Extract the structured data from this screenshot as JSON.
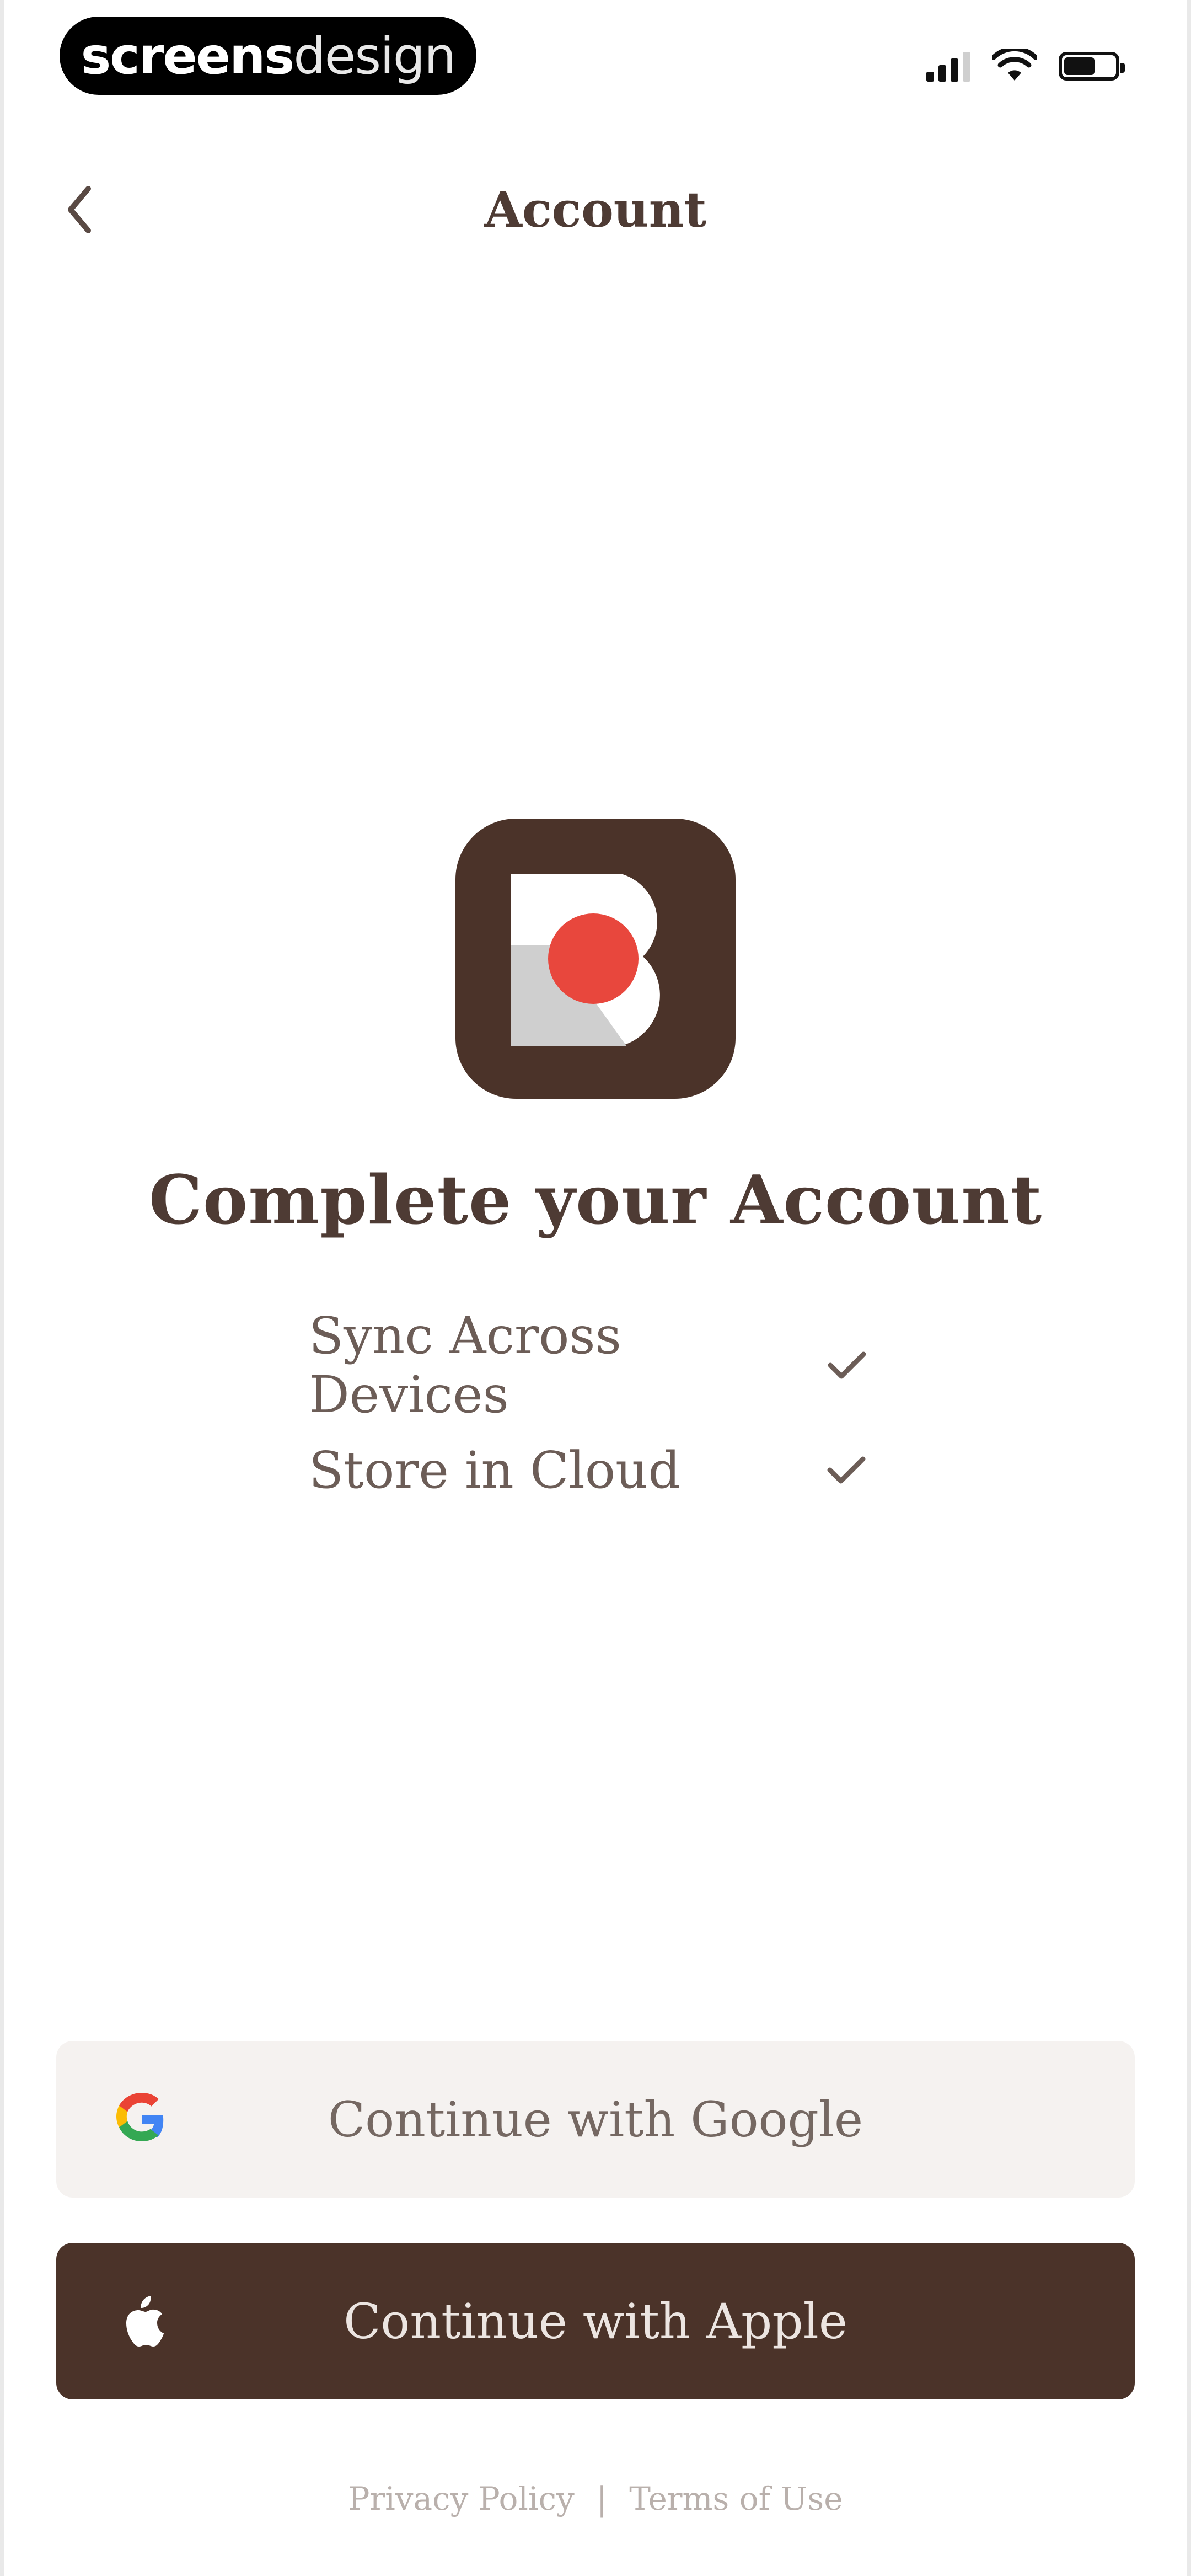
{
  "status_bar": {
    "badge_bold": "screens",
    "badge_light": "design",
    "icons": [
      "cellular-signal-icon",
      "wifi-icon",
      "battery-icon"
    ]
  },
  "nav": {
    "back_icon": "chevron-left-icon",
    "title": "Account"
  },
  "hero": {
    "logo": "app-logo-b-icon",
    "headline": "Complete your Account",
    "features": [
      {
        "label": "Sync Across Devices",
        "icon": "checkmark-icon"
      },
      {
        "label": "Store in Cloud",
        "icon": "checkmark-icon"
      }
    ]
  },
  "actions": {
    "google_label": "Continue with Google",
    "google_icon": "google-icon",
    "apple_label": "Continue with Apple",
    "apple_icon": "apple-icon"
  },
  "footer": {
    "privacy": "Privacy Policy",
    "separator": "|",
    "terms": "Terms of Use"
  },
  "colors": {
    "brand_brown": "#4b3329",
    "accent_red": "#e8473d",
    "text": "#4e3b34",
    "google_button_bg": "#f5f2f0"
  }
}
